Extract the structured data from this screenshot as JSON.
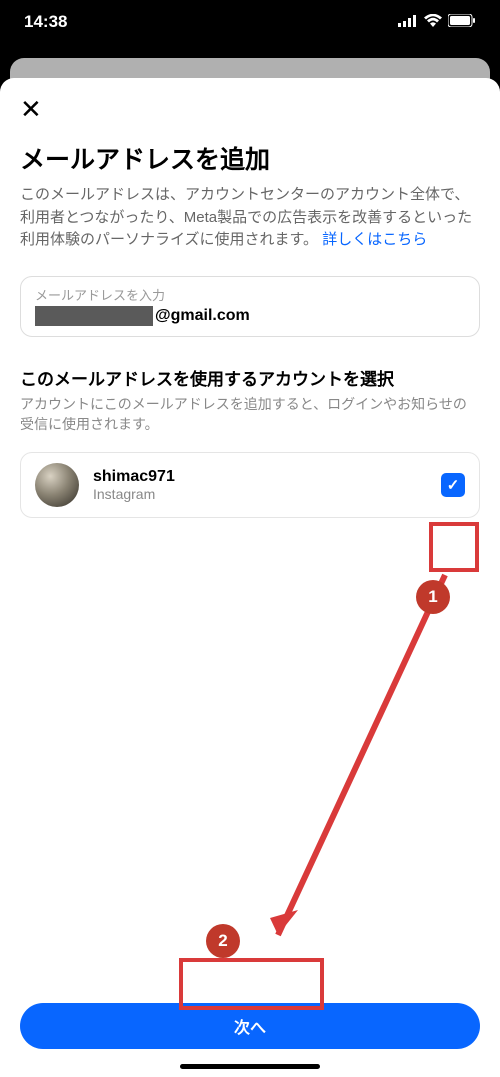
{
  "status": {
    "time": "14:38"
  },
  "sheet": {
    "close_glyph": "✕",
    "title": "メールアドレスを追加",
    "description_main": "このメールアドレスは、アカウントセンターのアカウント全体で、利用者とつながったり、Meta製品での広告表示を改善するといった利用体験のパーソナライズに使用されます。",
    "description_link": "詳しくはこちら",
    "input": {
      "label": "メールアドレスを入力",
      "value_suffix": "@gmail.com"
    },
    "section": {
      "title": "このメールアドレスを使用するアカウントを選択",
      "desc": "アカウントにこのメールアドレスを追加すると、ログインやお知らせの受信に使用されます。"
    },
    "account": {
      "name": "shimac971",
      "platform": "Instagram",
      "checked_glyph": "✓"
    },
    "next_label": "次へ"
  },
  "annotations": {
    "step1": "1",
    "step2": "2"
  }
}
